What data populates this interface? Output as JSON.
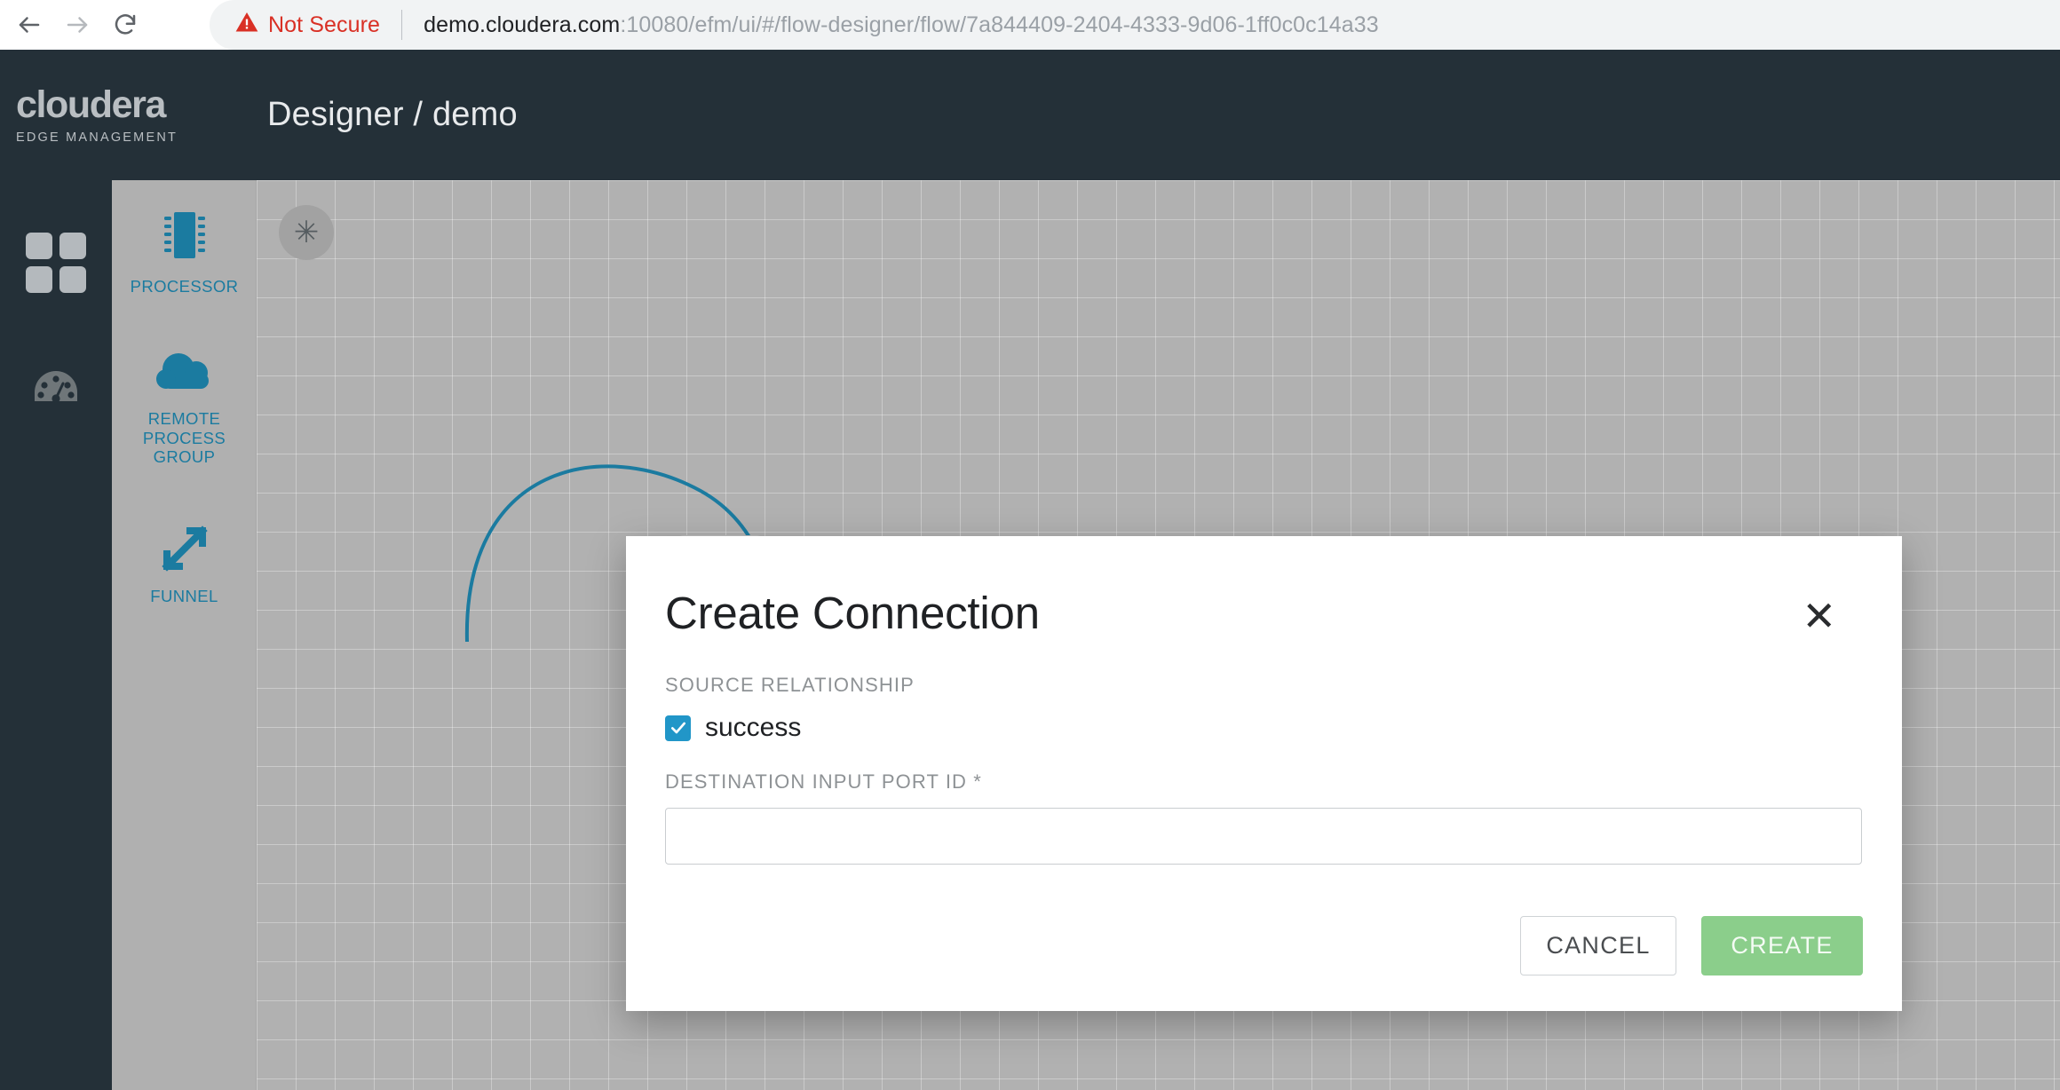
{
  "browser": {
    "back_icon": "arrow-left-icon",
    "forward_icon": "arrow-right-icon",
    "reload_icon": "reload-icon",
    "security_label": "Not Secure",
    "security_icon": "warning-triangle-icon",
    "url_host": "demo.cloudera.com",
    "url_path": ":10080/efm/ui/#/flow-designer/flow/7a844409-2404-4333-9d06-1ff0c0c14a33",
    "url_full": "demo.cloudera.com:10080/efm/ui/#/flow-designer/flow/7a844409-2404-4333-9d06-1ff0c0c14a33"
  },
  "header": {
    "logo_word": "cloudera",
    "logo_sub": "EDGE MANAGEMENT",
    "breadcrumb": "Designer / demo"
  },
  "rail": {
    "items": [
      {
        "name": "dashboard-grid",
        "icon": "grid-icon",
        "active": true
      },
      {
        "name": "monitor",
        "icon": "gauge-icon",
        "active": false
      }
    ]
  },
  "palette": {
    "items": [
      {
        "label": "PROCESSOR",
        "icon": "processor-chip-icon"
      },
      {
        "label": "REMOTE PROCESS GROUP",
        "icon": "cloud-icon"
      },
      {
        "label": "FUNNEL",
        "icon": "funnel-arrows-icon"
      }
    ]
  },
  "canvas": {
    "action_button_icon": "asterisk-icon",
    "action_button_glyph": "✳",
    "connection_color": "#1b7ba0"
  },
  "modal": {
    "title": "Create Connection",
    "close_icon": "close-icon",
    "close_glyph": "✕",
    "source_relationship_label": "SOURCE RELATIONSHIP",
    "relationships": [
      {
        "label": "success",
        "checked": true
      }
    ],
    "destination_label": "DESTINATION INPUT PORT ID *",
    "destination_value": "",
    "destination_placeholder": "",
    "cancel_label": "CANCEL",
    "create_label": "CREATE"
  },
  "colors": {
    "header_bg": "#243038",
    "accent_blue": "#1b7ba0",
    "checkbox_blue": "#2196c8",
    "create_green": "#8bce8b",
    "not_secure_red": "#d93025"
  }
}
